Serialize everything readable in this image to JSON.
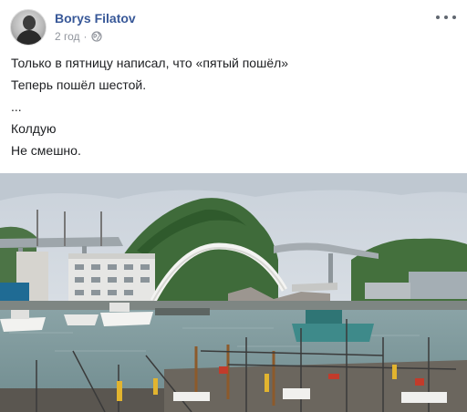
{
  "post": {
    "author": "Borys Filatov",
    "timestamp": "2 год",
    "separator": "·",
    "privacy_icon": "globe-icon",
    "more_icon": "more-options-icon",
    "lines": [
      "Только в пятницу написал, что «пятый пошёл»",
      "Теперь пошёл шестой.",
      "...",
      "Колдую",
      "Не смешно."
    ]
  },
  "colors": {
    "author_link": "#385898",
    "meta_text": "#90949c",
    "body_text": "#1c1e21"
  }
}
